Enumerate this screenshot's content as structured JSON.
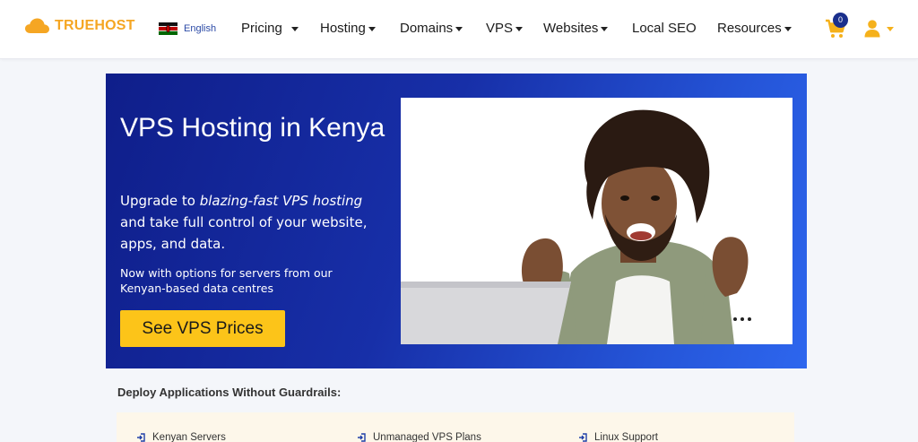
{
  "brand": {
    "name": "TRUEHOST",
    "color": "#f5a623"
  },
  "language": {
    "label": "English"
  },
  "nav": {
    "items": [
      {
        "label": "Pricing",
        "dropdown": true
      },
      {
        "label": "Hosting",
        "dropdown": true
      },
      {
        "label": "Domains",
        "dropdown": true
      },
      {
        "label": "VPS",
        "dropdown": true
      },
      {
        "label": "Websites",
        "dropdown": true
      },
      {
        "label": "Local SEO",
        "dropdown": false
      },
      {
        "label": "Resources",
        "dropdown": true
      }
    ],
    "cart_count": "0"
  },
  "hero": {
    "title": "VPS Hosting in Kenya",
    "desc_prefix": "Upgrade to ",
    "desc_emphasis": "blazing-fast VPS hosting",
    "desc_suffix": " and take full control of your website, apps, and data.",
    "subtext": "Now with options for servers from our Kenyan-based data centres",
    "cta_label": "See VPS Prices",
    "cta_color": "#fcc419"
  },
  "section": {
    "title": "Deploy Applications Without Guardrails:",
    "features": [
      {
        "label": "Kenyan Servers"
      },
      {
        "label": "Unmanaged VPS Plans"
      },
      {
        "label": "Linux Support"
      }
    ]
  }
}
